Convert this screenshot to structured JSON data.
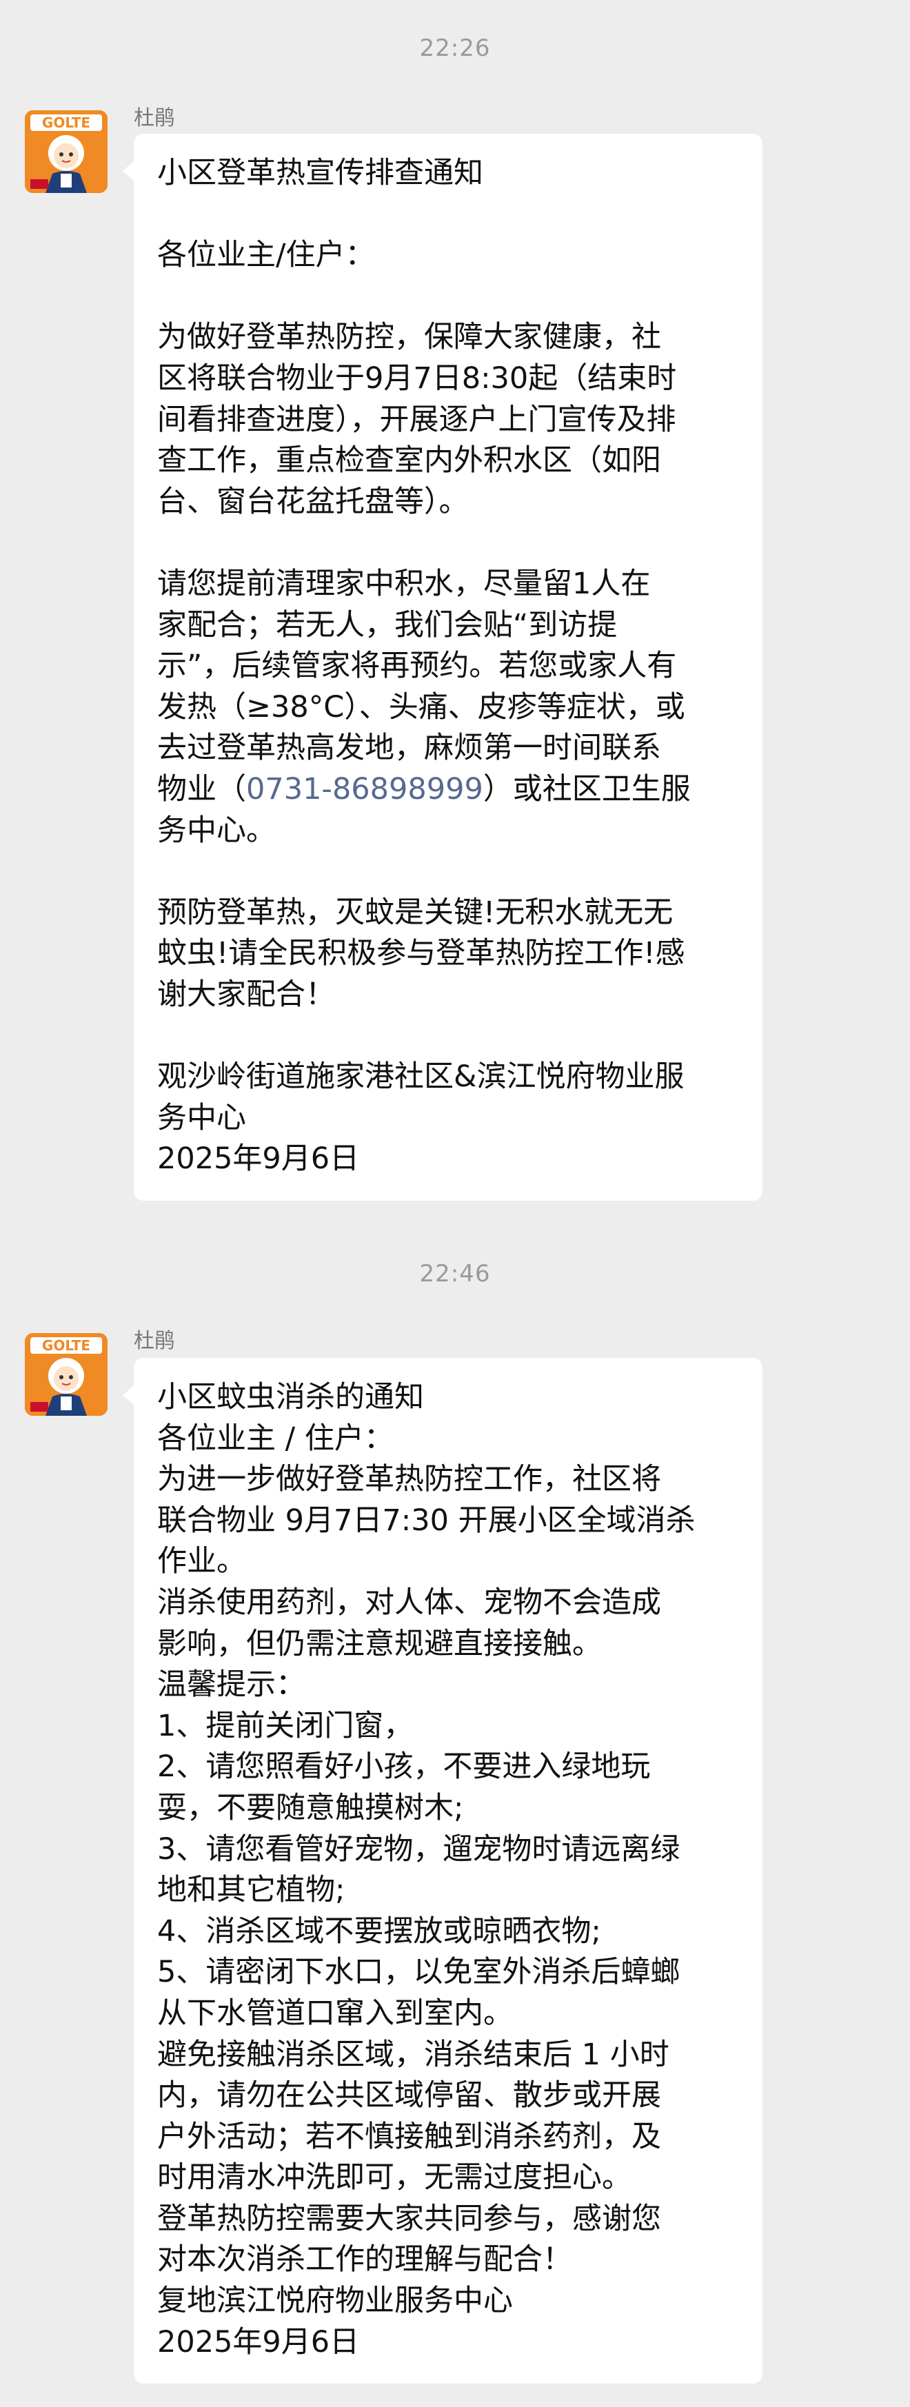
{
  "messages": [
    {
      "time": "22:26",
      "sender": "杜鹃",
      "avatar": "GOLTE 管家 mascot avatar",
      "lines": [
        "小区登革热宣传排查通知",
        "",
        "各位业主/住户：",
        "",
        "为做好登革热防控，保障大家健康，社",
        "区将联合物业于9月7日8:30起（结束时",
        "间看排查进度），开展逐户上门宣传及排",
        "查工作，重点检查室内外积水区（如阳",
        "台、窗台花盆托盘等）。",
        "",
        "请您提前清理家中积水，尽量留1人在",
        "家配合；若无人，我们会贴“到访提",
        "示”，后续管家将再预约。若您或家人有",
        "发热（≥38°C）、头痛、皮疹等症状，或",
        "去过登革热高发地，麻烦第一时间联系",
        "PHONE_LINE",
        "务中心。",
        "",
        "预防登革热，灭蚊是关键!无积水就无无",
        "蚊虫!请全民积极参与登革热防控工作!感",
        "谢大家配合！",
        "",
        "观沙岭街道施家港社区&滨江悦府物业服",
        "务中心",
        "2025年9月6日"
      ],
      "phone_line": {
        "before": "物业（",
        "phone": "0731-86898999",
        "after": "）或社区卫生服"
      }
    },
    {
      "time": "22:46",
      "sender": "杜鹃",
      "avatar": "GOLTE 管家 mascot avatar",
      "lines": [
        "小区蚊虫消杀的通知",
        "各位业主 / 住户：",
        "为进一步做好登革热防控工作，社区将",
        "联合物业 9月7日7:30 开展小区全域消杀",
        "作业。",
        "消杀使用药剂，对人体、宠物不会造成",
        "影响，但仍需注意规避直接接触。",
        "温馨提示：",
        "1、提前关闭门窗，",
        "2、请您照看好小孩，不要进入绿地玩",
        "耍，不要随意触摸树木;",
        "3、请您看管好宠物，遛宠物时请远离绿",
        "地和其它植物;",
        "4、消杀区域不要摆放或晾晒衣物;",
        "5、请密闭下水口，以免室外消杀后蟑螂",
        "从下水管道口窜入到室内。",
        "避免接触消杀区域，消杀结束后 1 小时",
        "内，请勿在公共区域停留、散步或开展",
        "户外活动；若不慎接触到消杀药剂，及",
        "时用清水冲洗即可，无需过度担心。",
        "登革热防控需要大家共同参与，感谢您",
        "对本次消杀工作的理解与配合！",
        "复地滨江悦府物业服务中心",
        "2025年9月6日"
      ]
    }
  ],
  "colors": {
    "background": "#ededed",
    "bubble": "#ffffff",
    "phone_link": "#56698f",
    "timestamp": "#9a9a9a"
  }
}
